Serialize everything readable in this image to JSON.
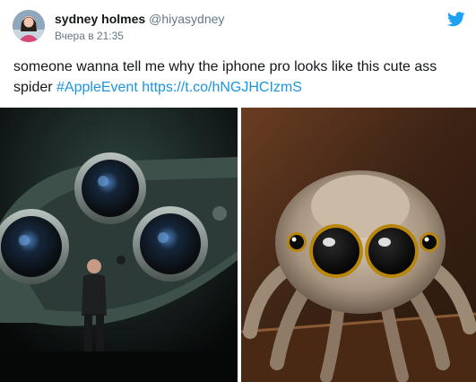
{
  "tweet": {
    "display_name": "sydney holmes",
    "handle": "@hiyasydney",
    "timestamp": "Вчера в 21:35",
    "text_prefix": "someone wanna tell me why the iphone pro looks like this cute ass spider ",
    "hashtag": "#AppleEvent",
    "link": "https://t.co/hNGJHCIzmS"
  },
  "colors": {
    "link": "#1b95e0",
    "secondary_text": "#657786",
    "twitter_blue": "#1da1f2"
  },
  "icons": {
    "brand": "twitter-bird-icon"
  },
  "media": {
    "left_image": "iphone-pro-camera-presentation",
    "right_image": "cartoon-jumping-spider"
  }
}
